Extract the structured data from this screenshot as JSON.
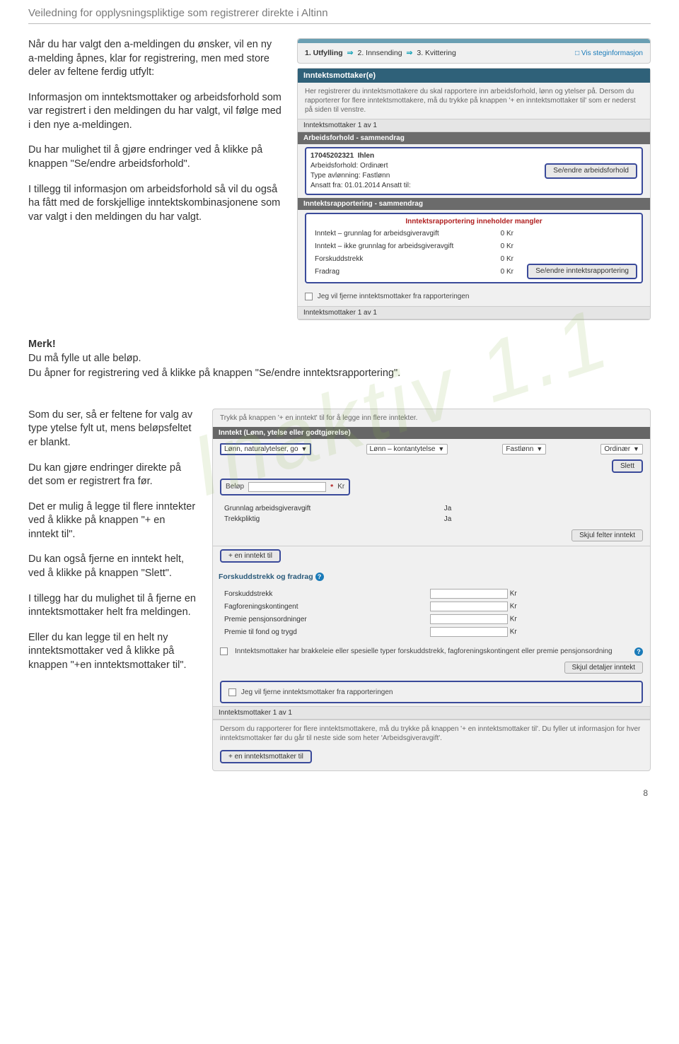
{
  "doc_header": "Veiledning for opplysningspliktige som registrerer direkte i Altinn",
  "para1": "Når du har valgt den a-meldingen du ønsker, vil en ny a-melding åpnes, klar for registrering, men med store deler av feltene ferdig utfylt:",
  "para2": "Informasjon om inntektsmottaker og arbeidsforhold som var registrert i den meldingen du har valgt, vil følge med i den nye a-meldingen.",
  "para3": "Du har mulighet til å gjøre endringer ved å klikke på knappen \"Se/endre arbeidsforhold\".",
  "para4": "I tillegg til informasjon om arbeidsforhold så vil du også ha fått med de forskjellige inntektskombinasjonene som var valgt i den meldingen du har valgt.",
  "merk": "Merk!",
  "merk_line1": "Du må fylle ut alle beløp.",
  "merk_line2": "Du åpner for registrering ved å klikke på knappen \"Se/endre inntektsrapportering\".",
  "para5": "Som du ser, så er feltene for valg av type ytelse fylt ut, mens beløpsfeltet er blankt.",
  "para6": "Du kan gjøre endringer direkte på det som er registrert fra før.",
  "para7": "Det er mulig å legge til flere inntekter ved å klikke på knappen \"+ en inntekt til\".",
  "para8": "Du kan også fjerne en inntekt helt, ved å klikke på knappen \"Slett\".",
  "para9": "I tillegg har du mulighet til å fjerne en inntektsmottaker helt fra meldingen.",
  "para10": "Eller du kan legge til en helt ny inntektsmottaker ved å klikke på knappen \"+en inntektsmottaker til\".",
  "page_no": "8",
  "scr1": {
    "step1": "1. Utfylling",
    "step2": "2. Innsending",
    "step3": "3. Kvittering",
    "vis_link": "Vis steginformasjon",
    "title": "Inntektsmottaker(e)",
    "desc": "Her registrerer du inntektsmottakere du skal rapportere inn arbeidsforhold, lønn og ytelser på. Dersom du rapporterer for flere inntektsmottakere, må du trykke på knappen '+ en inntektsmottaker til' som er nederst på siden til venstre.",
    "counter": "Inntektsmottaker 1 av 1",
    "arb_title": "Arbeidsforhold - sammendrag",
    "arb_id": "17045202321",
    "arb_name": "Ihlen",
    "arb_type": "Arbeidsforhold: Ordinært",
    "arb_avl": "Type avlønning: Fastlønn",
    "arb_fra": "Ansatt fra: 01.01.2014 Ansatt til:",
    "btn_arb": "Se/endre arbeidsforhold",
    "rapp_title": "Inntektsrapportering - sammendrag",
    "rapp_warn": "Inntektsrapportering inneholder mangler",
    "r1": "Inntekt – grunnlag for arbeidsgiveravgift",
    "r2": "Inntekt – ikke grunnlag for arbeidsgiveravgift",
    "r3": "Forskuddstrekk",
    "r4": "Fradrag",
    "rv": "0 Kr",
    "btn_rapp": "Se/endre inntektsrapportering",
    "fjern": "Jeg vil fjerne inntektsmottaker fra rapporteringen",
    "counter2": "Inntektsmottaker 1 av 1"
  },
  "scr2": {
    "hint": "Trykk på knappen '+ en inntekt' til for å legge inn flere inntekter.",
    "inntekt_header": "Inntekt (Lønn, ytelse eller godtgjørelse)",
    "sel1": "Lønn, naturalytelser, go",
    "sel2": "Lønn – kontantytelse",
    "sel3": "Fastlønn",
    "sel4": "Ordinær",
    "slett": "Slett",
    "belop": "Beløp",
    "kr": "Kr",
    "g1": "Grunnlag arbeidsgiveravgift",
    "g2": "Trekkpliktig",
    "ja": "Ja",
    "skjul1": "Skjul felter inntekt",
    "btn_add": "+ en inntekt til",
    "fs_title": "Forskuddstrekk og fradrag",
    "f1": "Forskuddstrekk",
    "f2": "Fagforeningskontingent",
    "f3": "Premie pensjonsordninger",
    "f4": "Premie til fond og trygd",
    "brakke": "Inntektsmottaker har brakkeleie eller spesielle typer forskuddstrekk, fagforeningskontingent eller premie pensjonsordning",
    "skjul2": "Skjul detaljer inntekt",
    "fjern": "Jeg vil fjerne inntektsmottaker fra rapporteringen",
    "counter": "Inntektsmottaker 1 av 1",
    "footer": "Dersom du rapporterer for flere inntektsmottakere, må du trykke på knappen '+ en inntektsmottaker til'. Du fyller ut informasjon for hver inntektsmottaker før du går til neste side som heter 'Arbeidsgiveravgift'.",
    "btn_add_im": "+ en inntektsmottaker til"
  }
}
